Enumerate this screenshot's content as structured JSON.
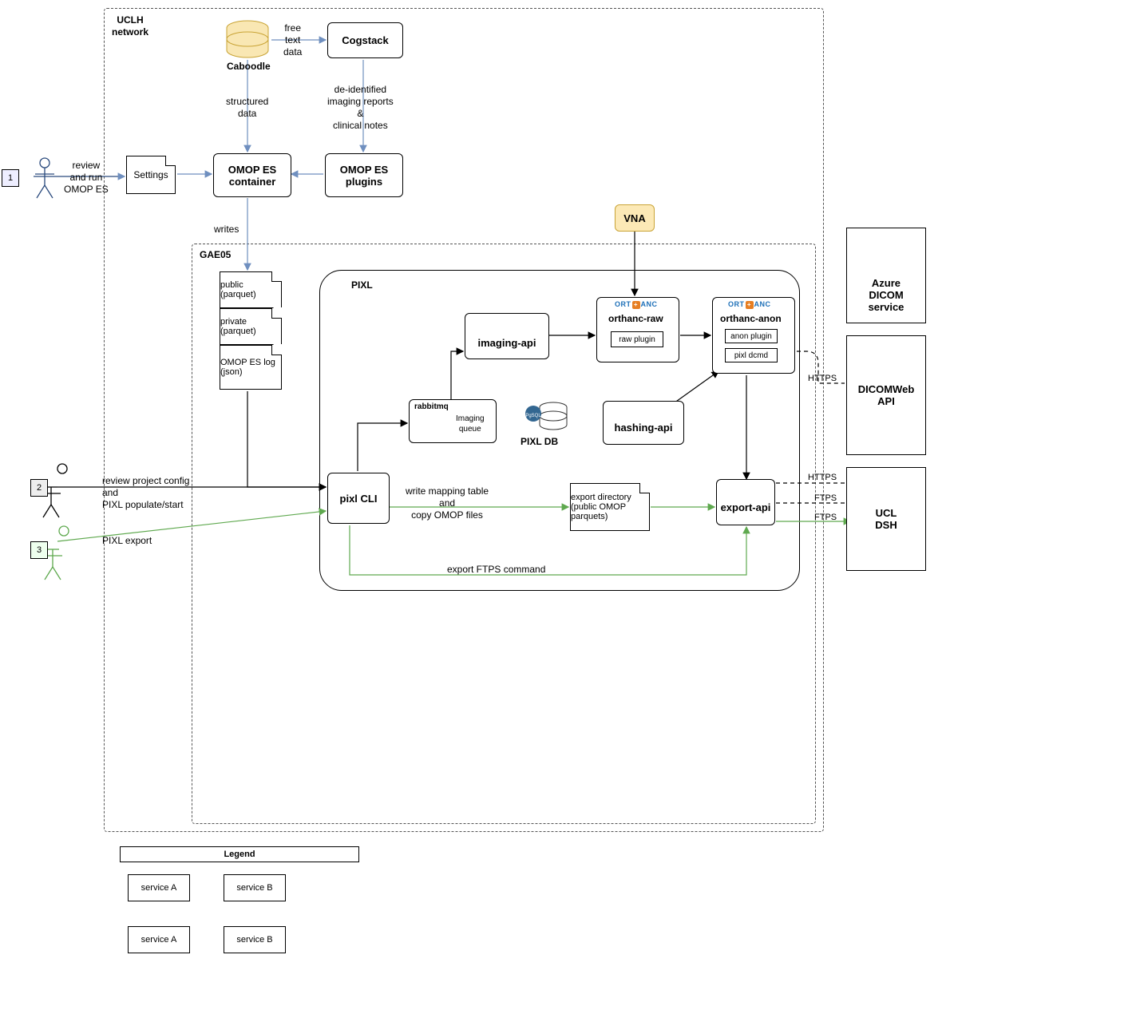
{
  "frames": {
    "uclh": "UCLH\nnetwork",
    "gae05": "GAE05",
    "pixl": "PIXL"
  },
  "nodes": {
    "caboodle": "Caboodle",
    "cogstack": "Cogstack",
    "omop_container": "OMOP ES\ncontainer",
    "omop_plugins": "OMOP ES\nplugins",
    "settings": "Settings",
    "vna": "VNA",
    "public_parquet": "public\n(parquet)",
    "private_parquet": "private\n(parquet)",
    "omop_log": "OMOP ES\nlog\n(json)",
    "pixl_cli": "pixl CLI",
    "rabbitmq": "rabbitmq",
    "imaging_queue": "Imaging\nqueue",
    "imaging_api": "imaging-api",
    "pixl_db": "PIXL DB",
    "orthanc_raw": "orthanc-raw",
    "raw_plugin": "raw plugin",
    "orthanc_anon": "orthanc-anon",
    "anon_plugin": "anon plugin",
    "pixl_dcmd": "pixl dcmd",
    "hashing_api": "hashing-api",
    "export_dir": "export directory\n(public OMOP\nparquets)",
    "export_api": "export-api"
  },
  "edges": {
    "free_text": "free\ntext\ndata",
    "structured": "structured\ndata",
    "deid": "de-identified\nimaging reports\n&\nclinical notes",
    "review_run": "review\nand run\nOMOP ES",
    "writes": "writes",
    "review_project": "review project config\nand\nPIXL populate/start",
    "pixl_export": "PIXL export",
    "write_mapping": "write mapping table\nand\ncopy OMOP files",
    "export_ftps": "export FTPS command",
    "https1": "HTTPS",
    "https2": "HTTPS",
    "ftps1": "FTPS",
    "ftps2": "FTPS"
  },
  "actors": {
    "a1": "1",
    "a2": "2",
    "a3": "3"
  },
  "external": {
    "azure": "Azure\nDICOM\nservice",
    "dicomweb": "DICOMWeb\nAPI",
    "dsh": "UCL\nDSH"
  },
  "legend": {
    "title": "Legend",
    "a1": "service A",
    "b1": "service B",
    "a2": "service A",
    "b2": "service B"
  }
}
